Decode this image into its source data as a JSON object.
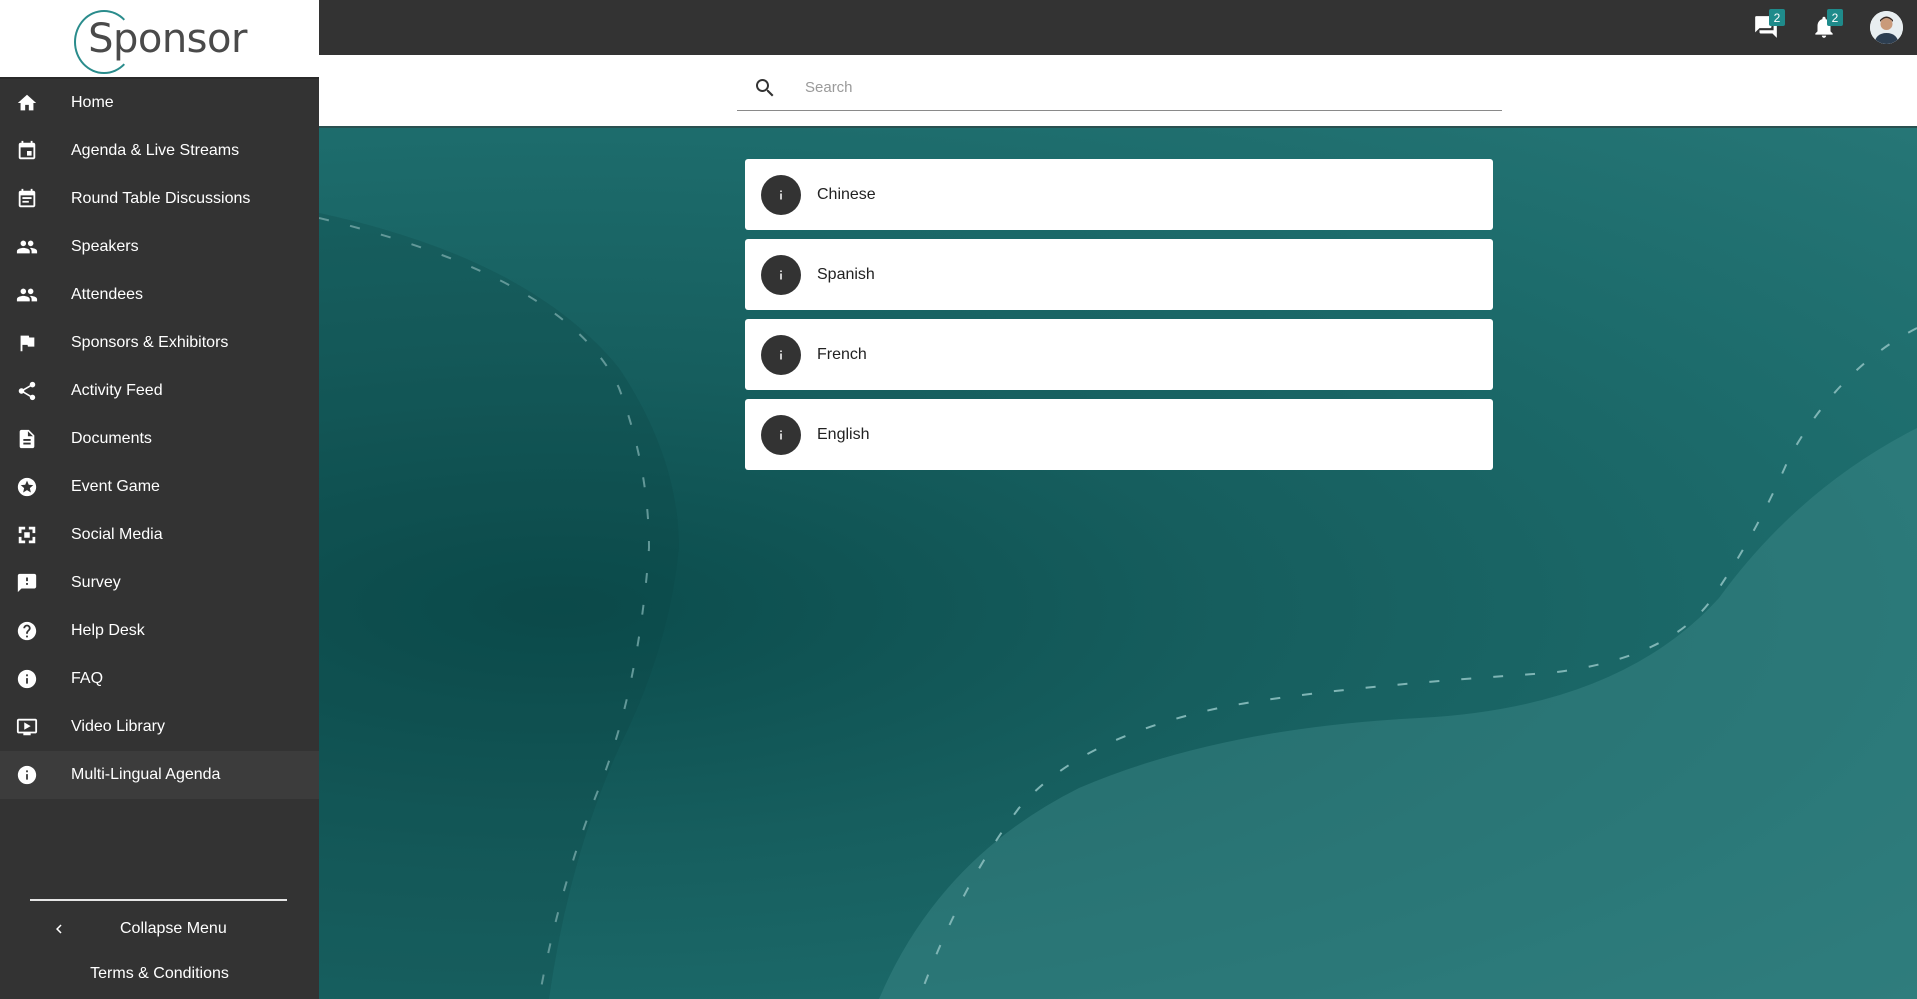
{
  "logo": {
    "text": "Sponsor"
  },
  "sidebar": {
    "items": [
      {
        "label": "Home",
        "icon": "home-icon"
      },
      {
        "label": "Agenda & Live Streams",
        "icon": "calendar-icon"
      },
      {
        "label": "Round Table Discussions",
        "icon": "calendar-icon"
      },
      {
        "label": "Speakers",
        "icon": "people-icon"
      },
      {
        "label": "Attendees",
        "icon": "people-icon"
      },
      {
        "label": "Sponsors & Exhibitors",
        "icon": "flag-icon"
      },
      {
        "label": "Activity Feed",
        "icon": "share-icon"
      },
      {
        "label": "Documents",
        "icon": "document-icon"
      },
      {
        "label": "Event Game",
        "icon": "star-icon"
      },
      {
        "label": "Social Media",
        "icon": "social-icon"
      },
      {
        "label": "Survey",
        "icon": "feedback-icon"
      },
      {
        "label": "Help Desk",
        "icon": "help-icon"
      },
      {
        "label": "FAQ",
        "icon": "info-icon"
      },
      {
        "label": "Video Library",
        "icon": "tv-icon"
      },
      {
        "label": "Multi-Lingual Agenda",
        "icon": "info-icon"
      }
    ],
    "active_index": 14,
    "collapse_label": "Collapse Menu",
    "terms_label": "Terms & Conditions"
  },
  "topbar": {
    "messages_badge": "2",
    "notifications_badge": "2"
  },
  "search": {
    "placeholder": "Search",
    "value": ""
  },
  "languages": [
    {
      "label": "Chinese"
    },
    {
      "label": "Spanish"
    },
    {
      "label": "French"
    },
    {
      "label": "English"
    }
  ],
  "colors": {
    "accent": "#1f8b8b",
    "sidebar_bg": "#333333",
    "topbar_bg": "#333333"
  }
}
